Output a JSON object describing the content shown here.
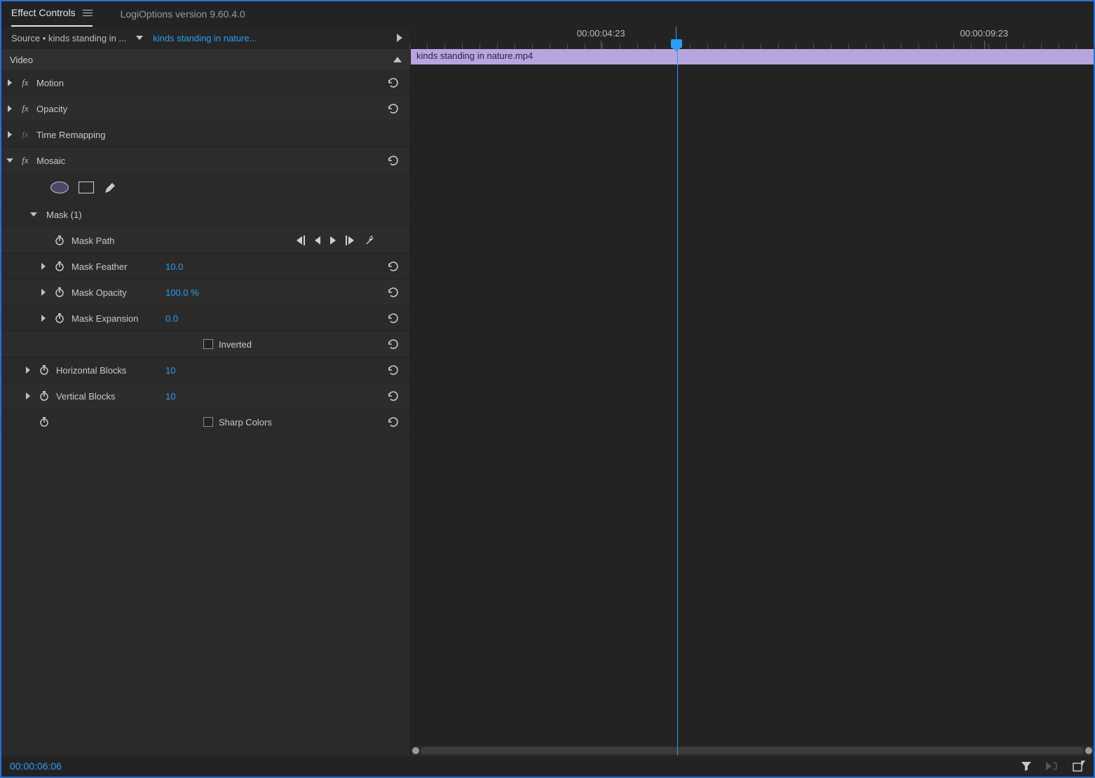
{
  "tabs": {
    "active": "Effect Controls",
    "inactive": "LogiOptions version 9.60.4.0"
  },
  "source": {
    "left": "Source • kinds standing in ...",
    "right": "kinds standing in nature..."
  },
  "section_header": "Video",
  "effects": {
    "motion": "Motion",
    "opacity": "Opacity",
    "time_remap": "Time Remapping",
    "mosaic": "Mosaic"
  },
  "mask": {
    "title": "Mask (1)",
    "path_label": "Mask Path",
    "feather_label": "Mask Feather",
    "feather_value": "10.0",
    "opacity_label": "Mask Opacity",
    "opacity_value": "100.0 %",
    "expansion_label": "Mask Expansion",
    "expansion_value": "0.0",
    "inverted_label": "Inverted"
  },
  "mosaic_props": {
    "hblocks_label": "Horizontal Blocks",
    "hblocks_value": "10",
    "vblocks_label": "Vertical Blocks",
    "vblocks_value": "10",
    "sharp_label": "Sharp Colors"
  },
  "timeline": {
    "tick1": "00:00:04:23",
    "tick2": "00:00:09:23",
    "clip_name": "kinds standing in nature.mp4"
  },
  "footer": {
    "timecode": "00:00:06:06"
  }
}
